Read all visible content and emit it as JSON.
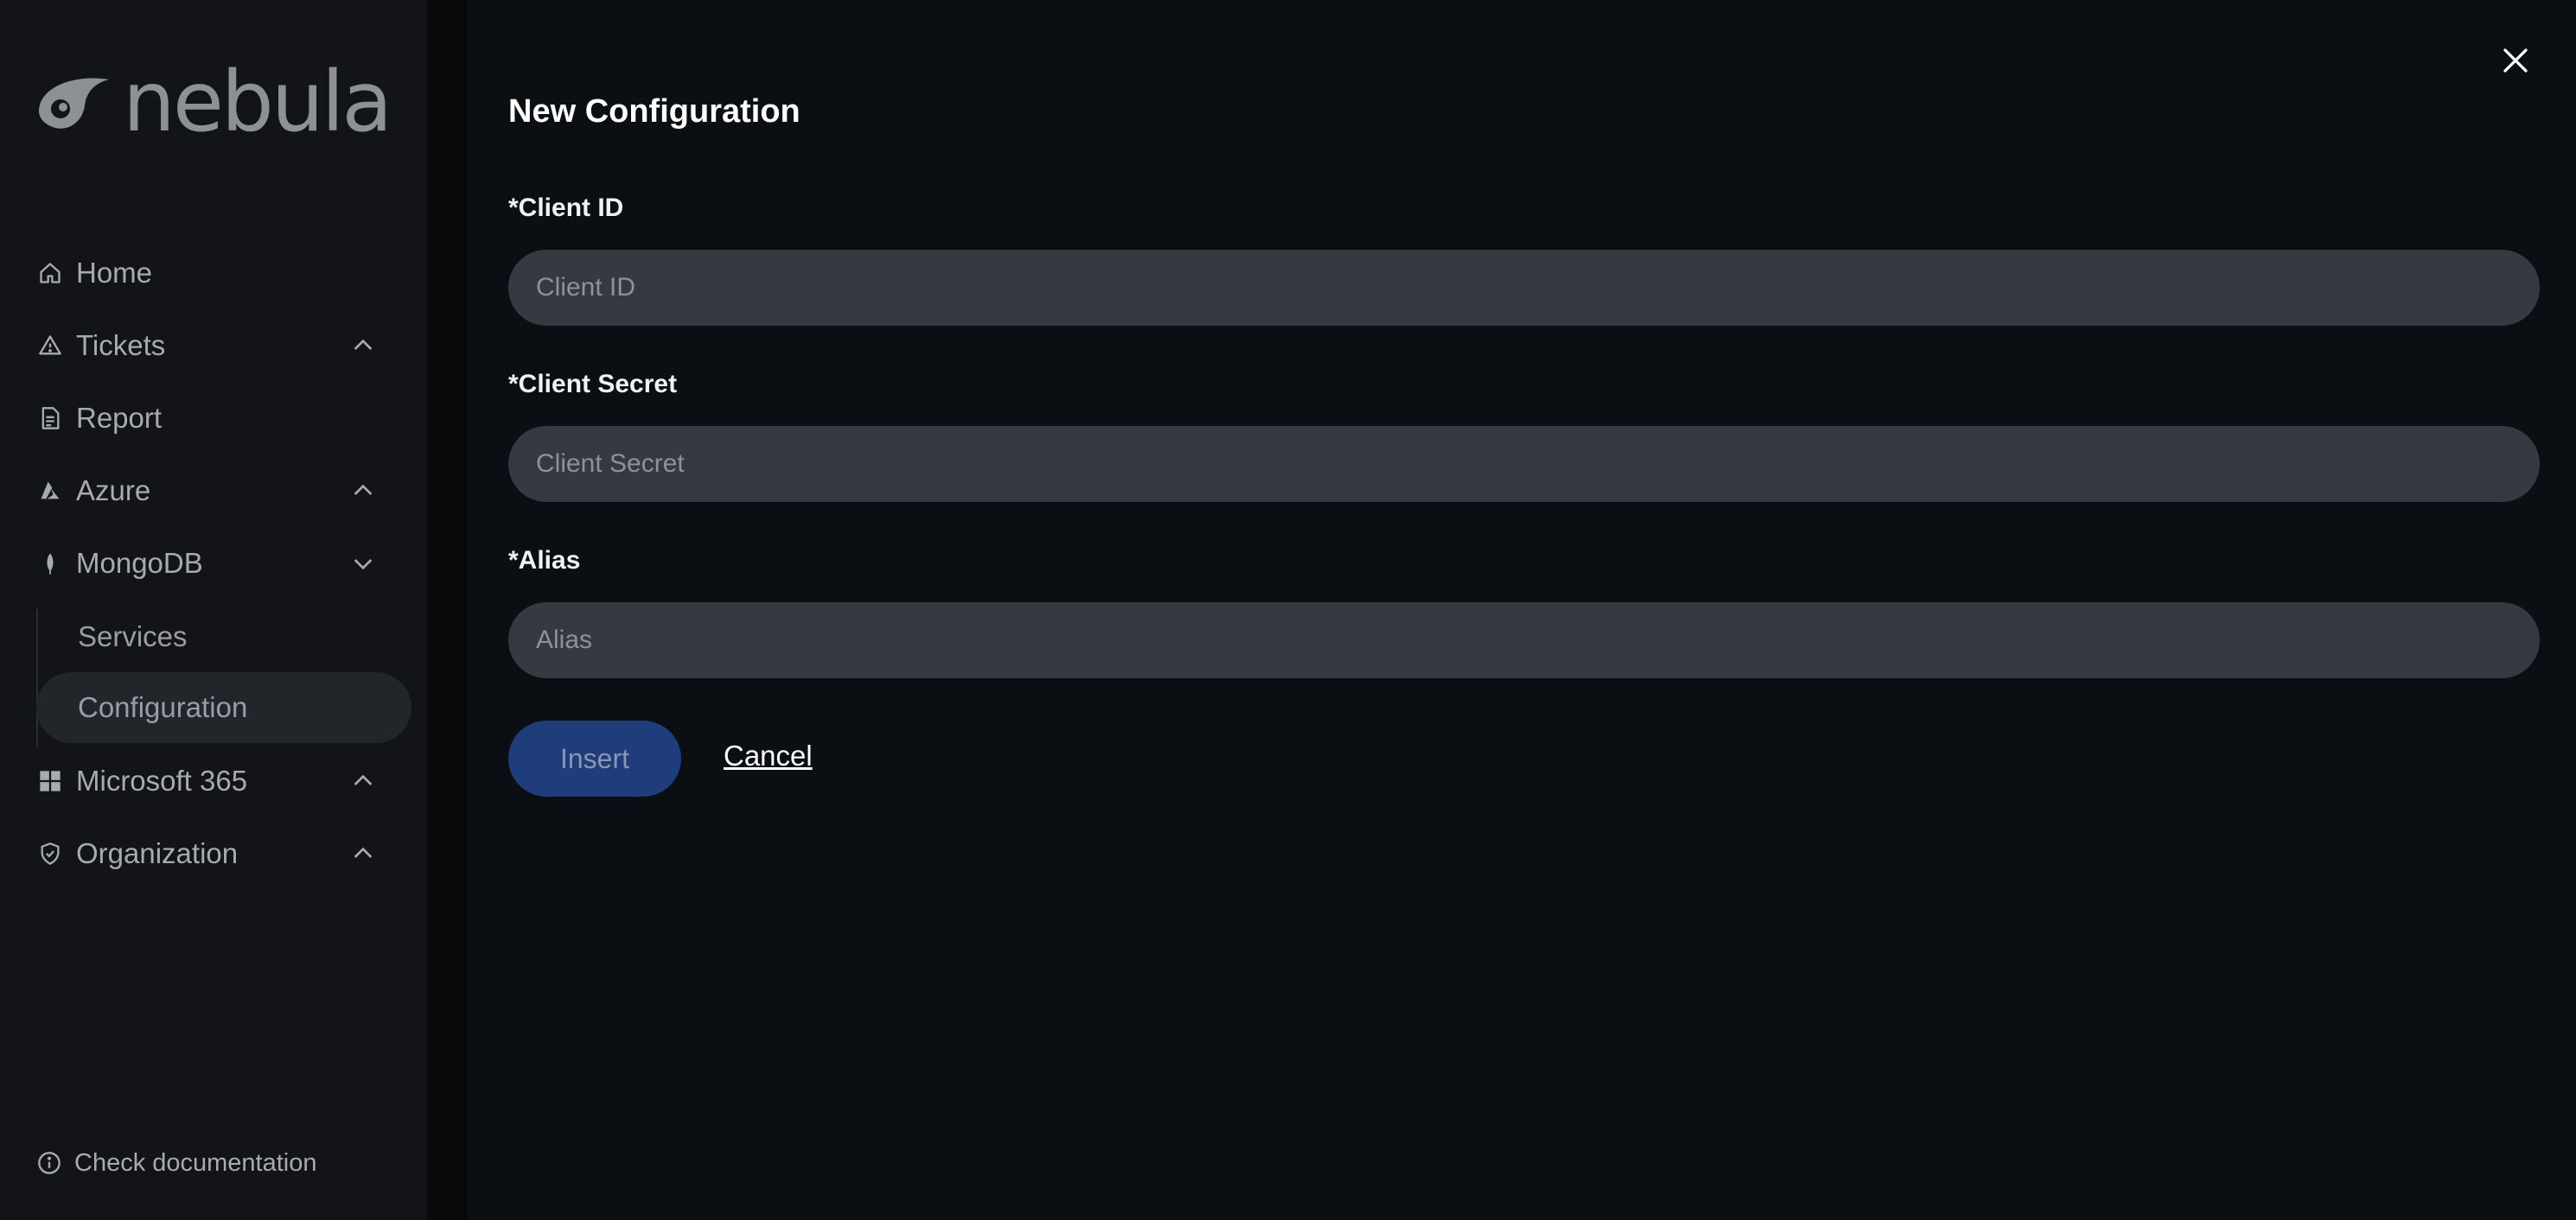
{
  "brand": {
    "name": "nebula"
  },
  "sidebar": {
    "items": [
      {
        "label": "Home",
        "icon": "home-icon"
      },
      {
        "label": "Tickets",
        "icon": "warning-icon",
        "chevron": "up"
      },
      {
        "label": "Report",
        "icon": "document-icon"
      },
      {
        "label": "Azure",
        "icon": "azure-icon",
        "chevron": "up"
      },
      {
        "label": "MongoDB",
        "icon": "mongodb-leaf-icon",
        "chevron": "down"
      },
      {
        "label": "Microsoft 365",
        "icon": "grid-icon",
        "chevron": "up"
      },
      {
        "label": "Organization",
        "icon": "shield-check-icon",
        "chevron": "up"
      }
    ],
    "subitems": [
      {
        "label": "Services"
      },
      {
        "label": "Configuration",
        "active": true
      }
    ],
    "footer": {
      "label": "Check documentation",
      "icon": "info-icon"
    }
  },
  "form": {
    "title": "New Configuration",
    "fields": [
      {
        "label": "*Client ID",
        "placeholder": "Client ID",
        "value": ""
      },
      {
        "label": "*Client Secret",
        "placeholder": "Client Secret",
        "value": ""
      },
      {
        "label": "*Alias",
        "placeholder": "Alias",
        "value": ""
      }
    ],
    "insert_label": "Insert",
    "cancel_label": "Cancel"
  },
  "colors": {
    "sidebar_bg": "#121418",
    "main_bg": "#0b0e12",
    "input_bg": "#36393f",
    "primary_disabled": "#1f3d7a"
  }
}
